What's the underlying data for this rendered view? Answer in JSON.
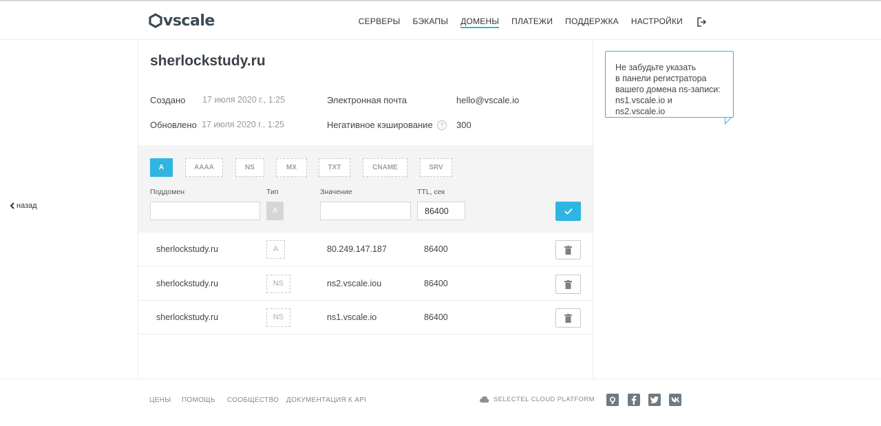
{
  "header": {
    "logo_text": "vscale",
    "nav": [
      "СЕРВЕРЫ",
      "БЭКАПЫ",
      "ДОМЕНЫ",
      "ПЛАТЕЖИ",
      "ПОДДЕРЖКА",
      "НАСТРОЙКИ"
    ],
    "active_nav": "ДОМЕНЫ",
    "logout_icon": "logout-icon"
  },
  "back": {
    "label": "назад",
    "icon": "chevron-left-icon"
  },
  "domain": {
    "title": "sherlockstudy.ru",
    "created_label": "Создано",
    "created_value": "17 июля 2020 г., 1:25",
    "updated_label": "Обновлено",
    "updated_value": "17 июля 2020 г., 1:25",
    "email_label": "Электронная почта",
    "email_value": "hello@vscale.io",
    "negative_cache_label": "Негативное кэширование",
    "negative_cache_help": "?",
    "negative_cache_value": "300"
  },
  "form": {
    "types": [
      "A",
      "AAAA",
      "NS",
      "MX",
      "TXT",
      "CNAME",
      "SRV"
    ],
    "active_type": "A",
    "subdomain_label": "Поддомен",
    "subdomain_value": "",
    "type_label": "Тип",
    "type_value": "A",
    "value_label": "Значение",
    "value_value": "",
    "ttl_label": "TTL, сек",
    "ttl_value": "86400",
    "submit_icon": "check-icon"
  },
  "records": [
    {
      "name": "sherlockstudy.ru",
      "type": "A",
      "value": "80.249.147.187",
      "ttl": "86400"
    },
    {
      "name": "sherlockstudy.ru",
      "type": "NS",
      "value": "ns2.vscale.iou",
      "ttl": "86400"
    },
    {
      "name": "sherlockstudy.ru",
      "type": "NS",
      "value": "ns1.vscale.io",
      "ttl": "86400"
    }
  ],
  "callout": {
    "lines": [
      "Не забудьте указать",
      "в панели регистратора",
      "вашего домена ns-записи:",
      "ns1.vscale.io и ns2.vscale.io"
    ]
  },
  "footer": {
    "links": [
      "ЦЕНЫ",
      "ПОМОЩЬ",
      "СООБЩЕСТВО",
      "ДОКУМЕНТАЦИЯ К API"
    ],
    "platform": "SELECTEL CLOUD PLATFORM",
    "social": [
      "github-icon",
      "facebook-icon",
      "twitter-icon",
      "vk-icon"
    ]
  },
  "colors": {
    "accent": "#2fb5e1",
    "text": "#333333",
    "muted": "#999999"
  }
}
